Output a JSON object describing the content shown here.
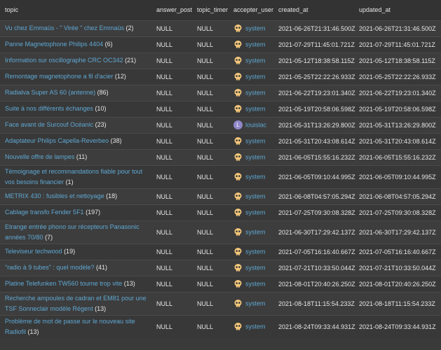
{
  "columns": [
    "topic",
    "answer_post",
    "topic_timer",
    "accepter_user",
    "created_at",
    "updated_at"
  ],
  "rows": [
    {
      "title": "Vu chez Emmaüs - \" Virée \" chez Emmaüs",
      "count": "(2)",
      "answer_post": "NULL",
      "topic_timer": "NULL",
      "user": "system",
      "avatar": "skull-icon",
      "created_at": "2021-06-26T21:31:46.500Z",
      "updated_at": "2021-06-26T21:31:46.500Z"
    },
    {
      "title": "Panne Magnetophone Philips 4404",
      "count": "(6)",
      "answer_post": "NULL",
      "topic_timer": "NULL",
      "user": "system",
      "avatar": "skull-icon",
      "created_at": "2021-07-29T11:45:01.721Z",
      "updated_at": "2021-07-29T11:45:01.721Z"
    },
    {
      "title": "Information sur oscillographe CRC OC342",
      "count": "(21)",
      "answer_post": "NULL",
      "topic_timer": "NULL",
      "user": "system",
      "avatar": "skull-icon",
      "created_at": "2021-05-12T18:38:58.115Z",
      "updated_at": "2021-05-12T18:38:58.115Z"
    },
    {
      "title": "Remontage magnetophone a fil d'acier",
      "count": "(12)",
      "answer_post": "NULL",
      "topic_timer": "NULL",
      "user": "system",
      "avatar": "skull-icon",
      "created_at": "2021-05-25T22:22:26.933Z",
      "updated_at": "2021-05-25T22:22:26.933Z"
    },
    {
      "title": "Radialva Super AS 60 (antenne)",
      "count": "(86)",
      "answer_post": "NULL",
      "topic_timer": "NULL",
      "user": "system",
      "avatar": "skull-icon",
      "created_at": "2021-06-22T19:23:01.340Z",
      "updated_at": "2021-06-22T19:23:01.340Z"
    },
    {
      "title": "Suite à nos différents échanges",
      "count": "(10)",
      "answer_post": "NULL",
      "topic_timer": "NULL",
      "user": "system",
      "avatar": "skull-icon",
      "created_at": "2021-05-19T20:58:06.598Z",
      "updated_at": "2021-05-19T20:58:06.598Z"
    },
    {
      "title": "Face avant de Surcouf Océanic",
      "count": "(23)",
      "answer_post": "NULL",
      "topic_timer": "NULL",
      "user": "louislac",
      "avatar": "L",
      "created_at": "2021-05-31T13:26:29.800Z",
      "updated_at": "2021-05-31T13:26:29.800Z"
    },
    {
      "title": "Adaptateur Philips Capella-Reverbeo",
      "count": "(38)",
      "answer_post": "NULL",
      "topic_timer": "NULL",
      "user": "system",
      "avatar": "skull-icon",
      "created_at": "2021-05-31T20:43:08.614Z",
      "updated_at": "2021-05-31T20:43:08.614Z"
    },
    {
      "title": "Nouvelle offre de lampes",
      "count": "(11)",
      "answer_post": "NULL",
      "topic_timer": "NULL",
      "user": "system",
      "avatar": "skull-icon",
      "created_at": "2021-06-05T15:55:16.232Z",
      "updated_at": "2021-06-05T15:55:16.232Z"
    },
    {
      "title": "Témoignage et recommandations fiable pour tout vos besoins financier",
      "count": "(1)",
      "answer_post": "NULL",
      "topic_timer": "NULL",
      "user": "system",
      "avatar": "skull-icon",
      "created_at": "2021-06-05T09:10:44.995Z",
      "updated_at": "2021-06-05T09:10:44.995Z"
    },
    {
      "title": "METRIX 430 : fusibles et nettoyage",
      "count": "(18)",
      "answer_post": "NULL",
      "topic_timer": "NULL",
      "user": "system",
      "avatar": "skull-icon",
      "created_at": "2021-06-08T04:57:05.294Z",
      "updated_at": "2021-06-08T04:57:05.294Z"
    },
    {
      "title": "Cablage transfo Fender 5F1",
      "count": "(197)",
      "answer_post": "NULL",
      "topic_timer": "NULL",
      "user": "system",
      "avatar": "skull-icon",
      "created_at": "2021-07-25T09:30:08.328Z",
      "updated_at": "2021-07-25T09:30:08.328Z"
    },
    {
      "title": "Etrange entrée phono sur récepteurs Panasonic années 70/80",
      "count": "(7)",
      "answer_post": "NULL",
      "topic_timer": "NULL",
      "user": "system",
      "avatar": "skull-icon",
      "created_at": "2021-06-30T17:29:42.137Z",
      "updated_at": "2021-06-30T17:29:42.137Z"
    },
    {
      "title": "Televiseur techwood",
      "count": "(19)",
      "answer_post": "NULL",
      "topic_timer": "NULL",
      "user": "system",
      "avatar": "skull-icon",
      "created_at": "2021-07-05T16:16:40.667Z",
      "updated_at": "2021-07-05T16:16:40.667Z"
    },
    {
      "title": "\"radio à 9 tubes\" : quel modèle?",
      "count": "(41)",
      "answer_post": "NULL",
      "topic_timer": "NULL",
      "user": "system",
      "avatar": "skull-icon",
      "created_at": "2021-07-21T10:33:50.044Z",
      "updated_at": "2021-07-21T10:33:50.044Z"
    },
    {
      "title": "Platine Telefunken TW560 tourne trop vite",
      "count": "(13)",
      "answer_post": "NULL",
      "topic_timer": "NULL",
      "user": "system",
      "avatar": "skull-icon",
      "created_at": "2021-08-01T20:40:26.250Z",
      "updated_at": "2021-08-01T20:40:26.250Z"
    },
    {
      "title": "Recherche ampoules de cadran et EM81 pour une TSF Sonneclair modèle Régent",
      "count": "(13)",
      "answer_post": "NULL",
      "topic_timer": "NULL",
      "user": "system",
      "avatar": "skull-icon",
      "created_at": "2021-08-18T11:15:54.233Z",
      "updated_at": "2021-08-18T11:15:54.233Z"
    },
    {
      "title": "Problème de mot de passe sur le nouveau site Radiofil",
      "count": "(13)",
      "answer_post": "NULL",
      "topic_timer": "NULL",
      "user": "system",
      "avatar": "skull-icon",
      "created_at": "2021-08-24T09:33:44.931Z",
      "updated_at": "2021-08-24T09:33:44.931Z"
    }
  ],
  "colors": {
    "link": "#5fa8d3",
    "background": "#3a3a3a",
    "avatar_l": "#8f87c8",
    "skull": "#f5c87a"
  }
}
